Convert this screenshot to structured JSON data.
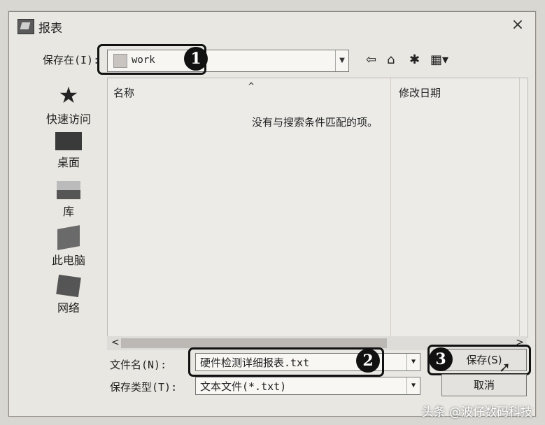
{
  "window": {
    "title": "报表",
    "close_glyph": "×"
  },
  "save_in": {
    "label": "保存在(I):",
    "value": "work"
  },
  "toolbar": {
    "back_icon": "back-arrow-icon",
    "up_icon": "up-folder-icon",
    "new_folder_icon": "new-folder-icon",
    "view_icon": "view-menu-icon"
  },
  "places": [
    {
      "label": "快速访问",
      "icon": "star-icon"
    },
    {
      "label": "桌面",
      "icon": "desktop-icon"
    },
    {
      "label": "库",
      "icon": "library-icon"
    },
    {
      "label": "此电脑",
      "icon": "computer-icon"
    },
    {
      "label": "网络",
      "icon": "network-icon"
    }
  ],
  "list": {
    "columns": [
      "名称",
      "修改日期"
    ],
    "empty_message": "没有与搜索条件匹配的项。"
  },
  "file_name": {
    "label": "文件名(N):",
    "value": "硬件检测详细报表.txt"
  },
  "file_type": {
    "label": "保存类型(T):",
    "value": "文本文件(*.txt)"
  },
  "buttons": {
    "save": "保存(S)",
    "cancel": "取消"
  },
  "callouts": [
    "1",
    "2",
    "3"
  ],
  "watermark": "头条 @波仔数码科技"
}
